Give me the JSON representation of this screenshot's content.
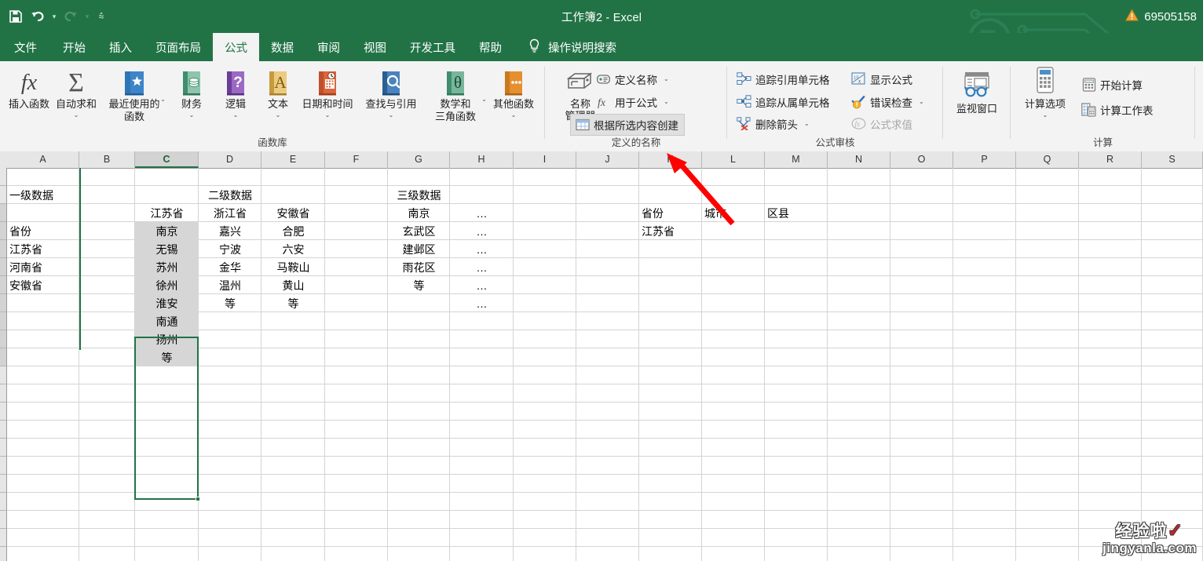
{
  "window": {
    "title": "工作簿2  -  Excel",
    "account_number": "69505158",
    "warning_icon": "warning-triangle-icon"
  },
  "quick_access": {
    "save": "save-icon",
    "undo": "undo-icon",
    "redo": "redo-icon",
    "customize": "customize-qat-icon"
  },
  "tabs": [
    {
      "label": "文件",
      "active": false
    },
    {
      "label": "开始",
      "active": false
    },
    {
      "label": "插入",
      "active": false
    },
    {
      "label": "页面布局",
      "active": false
    },
    {
      "label": "公式",
      "active": true
    },
    {
      "label": "数据",
      "active": false
    },
    {
      "label": "审阅",
      "active": false
    },
    {
      "label": "视图",
      "active": false
    },
    {
      "label": "开发工具",
      "active": false
    },
    {
      "label": "帮助",
      "active": false
    }
  ],
  "tell_me": {
    "label": "操作说明搜索",
    "icon": "lightbulb-icon"
  },
  "ribbon": {
    "groups": [
      {
        "name": "函数库",
        "label": "函数库",
        "buttons": [
          {
            "label": "插入函数",
            "icon": "fx-icon",
            "caret": false
          },
          {
            "label": "自动求和",
            "icon": "sigma-icon",
            "caret": true
          },
          {
            "label": "最近使用的\n函数",
            "icon": "recent-book-icon",
            "caret": true
          },
          {
            "label": "财务",
            "icon": "financial-book-icon",
            "caret": true
          },
          {
            "label": "逻辑",
            "icon": "logical-book-icon",
            "caret": true
          },
          {
            "label": "文本",
            "icon": "text-book-icon",
            "caret": true
          },
          {
            "label": "日期和时间",
            "icon": "datetime-book-icon",
            "caret": true
          },
          {
            "label": "查找与引用",
            "icon": "lookup-book-icon",
            "caret": true
          },
          {
            "label": "数学和\n三角函数",
            "icon": "math-book-icon",
            "caret": true
          },
          {
            "label": "其他函数",
            "icon": "more-functions-book-icon",
            "caret": true
          }
        ]
      },
      {
        "name": "定义的名称",
        "label": "定义的名称",
        "name_manager": {
          "line1": "名称",
          "line2": "管理器",
          "icon": "name-manager-icon"
        },
        "items": [
          {
            "label": "定义名称",
            "icon": "define-name-icon",
            "caret": true,
            "highlighted": false
          },
          {
            "label": "用于公式",
            "icon": "use-in-formula-icon",
            "caret": true,
            "highlighted": false
          },
          {
            "label": "根据所选内容创建",
            "icon": "create-from-selection-icon",
            "caret": false,
            "highlighted": true
          }
        ]
      },
      {
        "name": "公式审核",
        "label": "公式审核",
        "items": [
          {
            "label": "追踪引用单元格",
            "icon": "trace-precedents-icon",
            "caret": false,
            "disabled": false
          },
          {
            "label": "追踪从属单元格",
            "icon": "trace-dependents-icon",
            "caret": false,
            "disabled": false
          },
          {
            "label": "删除箭头",
            "icon": "remove-arrows-icon",
            "caret": true,
            "disabled": false
          },
          {
            "label": "显示公式",
            "icon": "show-formulas-icon",
            "caret": false,
            "disabled": false
          },
          {
            "label": "错误检查",
            "icon": "error-checking-icon",
            "caret": true,
            "disabled": false
          },
          {
            "label": "公式求值",
            "icon": "evaluate-formula-icon",
            "caret": false,
            "disabled": true
          }
        ]
      },
      {
        "name": "监视窗口",
        "label": "",
        "buttons": [
          {
            "label": "监视窗口",
            "icon": "watch-window-icon",
            "caret": false
          }
        ]
      },
      {
        "name": "计算",
        "label": "计算",
        "buttons": [
          {
            "label": "计算选项",
            "icon": "calc-options-icon",
            "caret": true
          }
        ],
        "items": [
          {
            "label": "开始计算",
            "icon": "calculate-now-icon",
            "caret": false
          },
          {
            "label": "计算工作表",
            "icon": "calculate-sheet-icon",
            "caret": false
          }
        ]
      }
    ]
  },
  "grid": {
    "columns": [
      "A",
      "B",
      "C",
      "D",
      "E",
      "F",
      "G",
      "H",
      "I",
      "J",
      "K",
      "L",
      "M",
      "N",
      "O",
      "P",
      "Q",
      "R",
      "S"
    ],
    "selected_column": "C",
    "selection_range": "C3:C11",
    "active_cell": "C3",
    "rows": [
      {
        "A": "一级数据",
        "C": "",
        "D": "",
        "E": "",
        "G": "二级数据",
        "H": "",
        "K": "",
        "L": "",
        "M": ""
      },
      {
        "A": "",
        "C": "江苏省",
        "D": "浙江省",
        "E": "安徽省",
        "G": "三级数据",
        "H": "",
        "K": "",
        "L": "",
        "M": ""
      }
    ],
    "cells": [
      {
        "ref": "A2",
        "col": 0,
        "row": 1,
        "text": "一级数据",
        "align": "left"
      },
      {
        "ref": "D2",
        "col": 3,
        "row": 1,
        "text": "二级数据",
        "align": "center"
      },
      {
        "ref": "G2",
        "col": 6,
        "row": 1,
        "text": "三级数据",
        "align": "center"
      },
      {
        "ref": "C3",
        "col": 2,
        "row": 2,
        "text": "江苏省",
        "align": "center"
      },
      {
        "ref": "D3",
        "col": 3,
        "row": 2,
        "text": "浙江省",
        "align": "center"
      },
      {
        "ref": "E3",
        "col": 4,
        "row": 2,
        "text": "安徽省",
        "align": "center"
      },
      {
        "ref": "G3",
        "col": 6,
        "row": 2,
        "text": "南京",
        "align": "center"
      },
      {
        "ref": "H3",
        "col": 7,
        "row": 2,
        "text": "…",
        "align": "center"
      },
      {
        "ref": "K3",
        "col": 10,
        "row": 2,
        "text": "省份",
        "align": "left"
      },
      {
        "ref": "L3",
        "col": 11,
        "row": 2,
        "text": "城市",
        "align": "left"
      },
      {
        "ref": "M3",
        "col": 12,
        "row": 2,
        "text": "区县",
        "align": "left"
      },
      {
        "ref": "A4",
        "col": 0,
        "row": 3,
        "text": "省份",
        "align": "left"
      },
      {
        "ref": "C4",
        "col": 2,
        "row": 3,
        "text": "南京",
        "align": "center",
        "selected": true
      },
      {
        "ref": "D4",
        "col": 3,
        "row": 3,
        "text": "嘉兴",
        "align": "center"
      },
      {
        "ref": "E4",
        "col": 4,
        "row": 3,
        "text": "合肥",
        "align": "center"
      },
      {
        "ref": "G4",
        "col": 6,
        "row": 3,
        "text": "玄武区",
        "align": "center"
      },
      {
        "ref": "H4",
        "col": 7,
        "row": 3,
        "text": "…",
        "align": "center"
      },
      {
        "ref": "K4",
        "col": 10,
        "row": 3,
        "text": "江苏省",
        "align": "left"
      },
      {
        "ref": "A5",
        "col": 0,
        "row": 4,
        "text": "江苏省",
        "align": "left"
      },
      {
        "ref": "C5",
        "col": 2,
        "row": 4,
        "text": "无锡",
        "align": "center",
        "selected": true
      },
      {
        "ref": "D5",
        "col": 3,
        "row": 4,
        "text": "宁波",
        "align": "center"
      },
      {
        "ref": "E5",
        "col": 4,
        "row": 4,
        "text": "六安",
        "align": "center"
      },
      {
        "ref": "G5",
        "col": 6,
        "row": 4,
        "text": "建邺区",
        "align": "center"
      },
      {
        "ref": "H5",
        "col": 7,
        "row": 4,
        "text": "…",
        "align": "center"
      },
      {
        "ref": "A6",
        "col": 0,
        "row": 5,
        "text": "河南省",
        "align": "left"
      },
      {
        "ref": "C6",
        "col": 2,
        "row": 5,
        "text": "苏州",
        "align": "center",
        "selected": true
      },
      {
        "ref": "D6",
        "col": 3,
        "row": 5,
        "text": "金华",
        "align": "center"
      },
      {
        "ref": "E6",
        "col": 4,
        "row": 5,
        "text": "马鞍山",
        "align": "center"
      },
      {
        "ref": "G6",
        "col": 6,
        "row": 5,
        "text": "雨花区",
        "align": "center"
      },
      {
        "ref": "H6",
        "col": 7,
        "row": 5,
        "text": "…",
        "align": "center"
      },
      {
        "ref": "A7",
        "col": 0,
        "row": 6,
        "text": "安徽省",
        "align": "left"
      },
      {
        "ref": "C7",
        "col": 2,
        "row": 6,
        "text": "徐州",
        "align": "center",
        "selected": true
      },
      {
        "ref": "D7",
        "col": 3,
        "row": 6,
        "text": "温州",
        "align": "center"
      },
      {
        "ref": "E7",
        "col": 4,
        "row": 6,
        "text": "黄山",
        "align": "center"
      },
      {
        "ref": "G7",
        "col": 6,
        "row": 6,
        "text": "等",
        "align": "center"
      },
      {
        "ref": "H7",
        "col": 7,
        "row": 6,
        "text": "…",
        "align": "center"
      },
      {
        "ref": "C8",
        "col": 2,
        "row": 7,
        "text": "淮安",
        "align": "center",
        "selected": true
      },
      {
        "ref": "D8",
        "col": 3,
        "row": 7,
        "text": "等",
        "align": "center"
      },
      {
        "ref": "E8",
        "col": 4,
        "row": 7,
        "text": "等",
        "align": "center"
      },
      {
        "ref": "H8",
        "col": 7,
        "row": 7,
        "text": "…",
        "align": "center"
      },
      {
        "ref": "C9",
        "col": 2,
        "row": 8,
        "text": "南通",
        "align": "center",
        "selected": true
      },
      {
        "ref": "C10",
        "col": 2,
        "row": 9,
        "text": "扬州",
        "align": "center",
        "selected": true
      },
      {
        "ref": "C11",
        "col": 2,
        "row": 10,
        "text": "等",
        "align": "center",
        "selected": true
      }
    ]
  },
  "annotations": {
    "red_box_target": "根据所选内容创建",
    "red_arrow": "points from column K header up to the 定义的名称 group"
  },
  "watermark": {
    "line1": "经验啦",
    "line2": "jingyanla.com",
    "check": "✓"
  },
  "colors": {
    "excel_green": "#217346",
    "ribbon_bg": "#f3f3f3",
    "selection_green": "#217346",
    "selection_fill": "#d6d6d6",
    "annotation_red": "#ff0000",
    "grid_line": "#d4d4d4"
  }
}
